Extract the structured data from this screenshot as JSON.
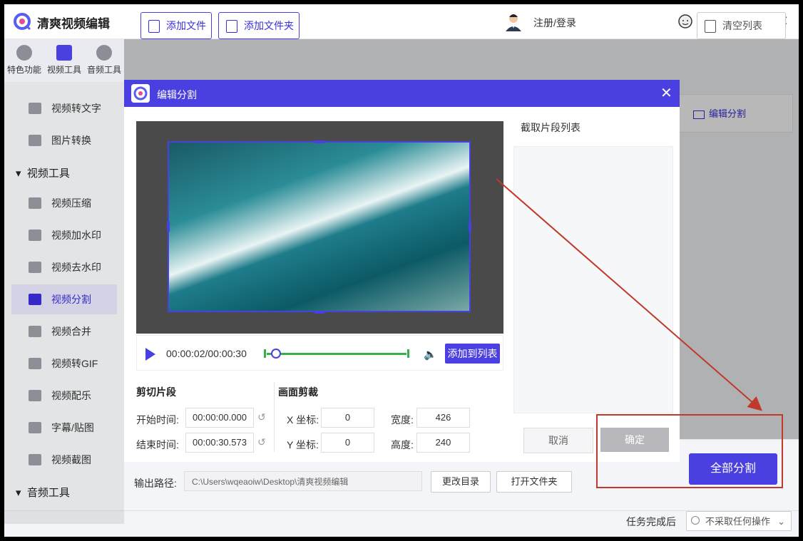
{
  "app": {
    "title": "清爽视频编辑",
    "user_label": "注册/登录",
    "service_label": "客服"
  },
  "top_tabs": [
    "特色功能",
    "视频工具",
    "音频工具"
  ],
  "sidebar": {
    "items_top": [
      "视频转文字",
      "图片转换"
    ],
    "group_video": "视频工具",
    "items_video": [
      "视频压缩",
      "视频加水印",
      "视频去水印",
      "视频分割",
      "视频合并",
      "视频转GIF",
      "视频配乐",
      "字幕/贴图",
      "视频截图"
    ],
    "group_audio": "音频工具"
  },
  "toolbar": {
    "add_file": "添加文件",
    "add_folder": "添加文件夹",
    "clear_list": "清空列表"
  },
  "background": {
    "edit_split_link": "编辑分割"
  },
  "bottom": {
    "output_label": "输出路径:",
    "output_path": "C:\\Users\\wqeaoiw\\Desktop\\清爽视频编辑",
    "change_dir": "更改目录",
    "open_folder": "打开文件夹",
    "split_all": "全部分割",
    "after_done_label": "任务完成后",
    "after_done_value": "不采取任何操作"
  },
  "dialog": {
    "title": "编辑分割",
    "timecode": "00:00:02/00:00:30",
    "playback_fraction": 0.067,
    "add_to_list": "添加到列表",
    "clip_section": "剪切片段",
    "start_label": "开始时间:",
    "start_value": "00:00:00.000",
    "end_label": "结束时间:",
    "end_value": "00:00:30.573",
    "crop_section": "画面剪裁",
    "x_label": "X 坐标:",
    "x_value": "0",
    "y_label": "Y 坐标:",
    "y_value": "0",
    "width_label": "宽度:",
    "width_value": "426",
    "height_label": "高度:",
    "height_value": "240",
    "list_title": "截取片段列表",
    "cancel": "取消",
    "ok": "确定"
  },
  "colors": {
    "accent": "#4a3fe0",
    "annotation": "#c0392b",
    "track": "#33b24a"
  }
}
